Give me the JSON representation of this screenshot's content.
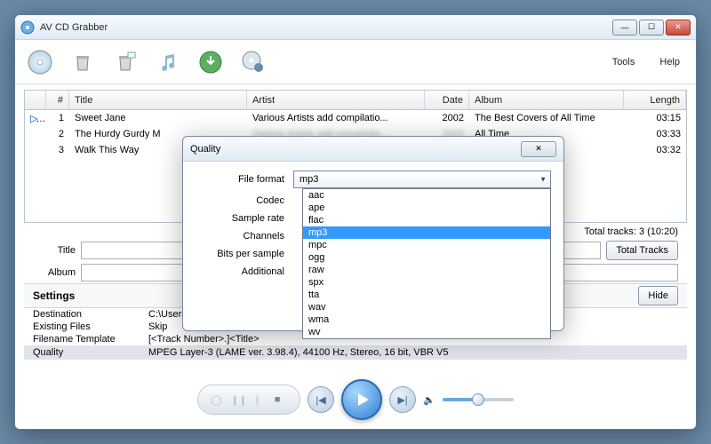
{
  "window": {
    "title": "AV CD Grabber"
  },
  "menu": {
    "tools": "Tools",
    "help": "Help"
  },
  "columns": {
    "num": "#",
    "title": "Title",
    "artist": "Artist",
    "date": "Date",
    "album": "Album",
    "length": "Length"
  },
  "tracks": [
    {
      "num": "1",
      "title": "Sweet Jane",
      "artist": "Various Artists add compilatio...",
      "date": "2002",
      "album": "The Best Covers of All Time",
      "length": "03:15",
      "playing": true
    },
    {
      "num": "2",
      "title": "The Hurdy Gurdy M",
      "artist": "",
      "date": "",
      "album": "All Time",
      "length": "03:33",
      "playing": false
    },
    {
      "num": "3",
      "title": "Walk This Way",
      "artist": "",
      "date": "",
      "album": "All Time",
      "length": "03:32",
      "playing": false
    }
  ],
  "totals": {
    "label": "Total tracks: 3 (10:20)",
    "button": "Total Tracks"
  },
  "form": {
    "title_label": "Title",
    "album_label": "Album"
  },
  "settings": {
    "header": "Settings",
    "hide": "Hide",
    "rows": {
      "destination_k": "Destination",
      "destination_v": "C:\\Users\\",
      "existing_k": "Existing Files",
      "existing_v": "Skip",
      "template_k": "Filename Template",
      "template_v": "[<Track Number>.]<Title>",
      "quality_k": "Quality",
      "quality_v": "MPEG Layer-3 (LAME ver. 3.98.4), 44100 Hz, Stereo, 16 bit, VBR V5"
    }
  },
  "dialog": {
    "title": "Quality",
    "labels": {
      "file_format": "File format",
      "codec": "Codec",
      "sample_rate": "Sample rate",
      "channels": "Channels",
      "bits": "Bits per sample",
      "additional": "Additional"
    },
    "selected_format": "mp3",
    "options": [
      "aac",
      "ape",
      "flac",
      "mp3",
      "mpc",
      "ogg",
      "raw",
      "spx",
      "tta",
      "wav",
      "wma",
      "wv"
    ]
  }
}
